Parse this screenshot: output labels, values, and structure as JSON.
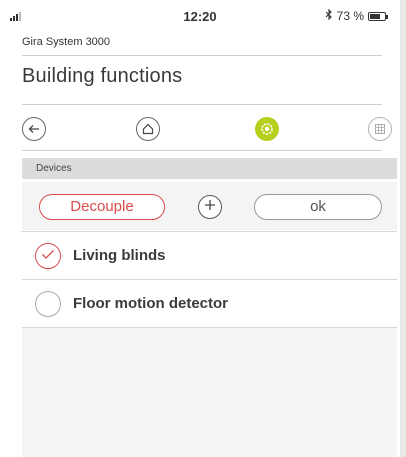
{
  "status_bar": {
    "time": "12:20",
    "battery_text": "73 %",
    "battery_level_percent": 73,
    "bluetooth_icon": "bluetooth-icon"
  },
  "header": {
    "system_name": "Gira System 3000",
    "title": "Building functions"
  },
  "nav": [
    {
      "name": "back",
      "icon": "back-arrow-icon"
    },
    {
      "name": "home",
      "icon": "home-icon"
    },
    {
      "name": "functions",
      "icon": "functions-icon",
      "active": true,
      "color": "#b6cf1c"
    },
    {
      "name": "grid",
      "icon": "grid-icon"
    }
  ],
  "devices_section": {
    "heading": "Devices",
    "decouple_label": "Decouple",
    "add_icon": "plus-icon",
    "ok_label": "ok",
    "accent_color": "#d94c4c"
  },
  "devices": [
    {
      "label": "Living blinds",
      "checked": true
    },
    {
      "label": "Floor motion detector",
      "checked": false
    }
  ]
}
